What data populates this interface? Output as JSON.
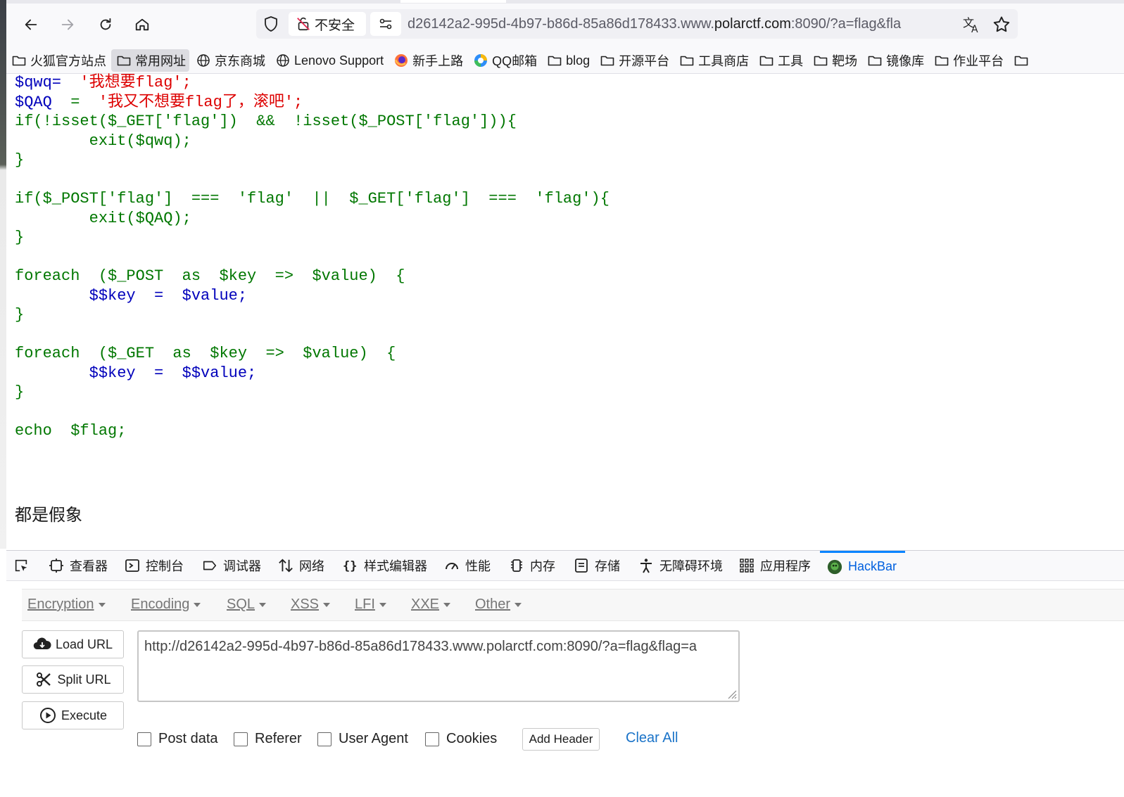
{
  "browser": {
    "security_label": "不安全",
    "url_prefix": "d26142a2-995d-4b97-b86d-85a86d178433.www.",
    "url_domain": "polarctf.com",
    "url_suffix": ":8090/?a=flag&fla"
  },
  "bookmarks": [
    {
      "label": "火狐官方站点",
      "icon": "folder-icon"
    },
    {
      "label": "常用网址",
      "icon": "folder-icon",
      "active": true
    },
    {
      "label": "京东商城",
      "icon": "globe-icon"
    },
    {
      "label": "Lenovo Support",
      "icon": "globe-icon"
    },
    {
      "label": "新手上路",
      "icon": "firefox-icon"
    },
    {
      "label": "QQ邮箱",
      "icon": "qqmail-icon"
    },
    {
      "label": "blog",
      "icon": "folder-icon"
    },
    {
      "label": "开源平台",
      "icon": "folder-icon"
    },
    {
      "label": "工具商店",
      "icon": "folder-icon"
    },
    {
      "label": "工具",
      "icon": "folder-icon"
    },
    {
      "label": "靶场",
      "icon": "folder-icon"
    },
    {
      "label": "镜像库",
      "icon": "folder-icon"
    },
    {
      "label": "作业平台",
      "icon": "folder-icon"
    }
  ],
  "code": {
    "l1_var": "$qwq=",
    "l1_str": "'我想要flag';",
    "l2_var": "$QAQ",
    "l2_eq": "=",
    "l2_str": "'我又不想要flag了，滚吧';",
    "l3": "if(!isset($_GET['flag'])  &&  !isset($_POST['flag'])){",
    "l4": "exit($qwq);",
    "l5": "}",
    "l7": "if($_POST['flag']  ===  'flag'  ||  $_GET['flag']  ===  'flag'){",
    "l8": "exit($QAQ);",
    "l9": "}",
    "l11": "foreach  ($_POST  as  $key  =>  $value)  {",
    "l12": "$$key  =  $value;",
    "l13": "}",
    "l15": "foreach  ($_GET  as  $key  =>  $value)  {",
    "l16": "$$key  =  $$value;",
    "l17": "}",
    "l19": "echo  $flag;"
  },
  "page_output": "都是假象",
  "devtools": {
    "tabs": [
      {
        "label": "查看器",
        "icon": "inspector-icon"
      },
      {
        "label": "控制台",
        "icon": "console-icon"
      },
      {
        "label": "调试器",
        "icon": "debugger-icon"
      },
      {
        "label": "网络",
        "icon": "network-icon"
      },
      {
        "label": "样式编辑器",
        "icon": "style-editor-icon"
      },
      {
        "label": "性能",
        "icon": "performance-icon"
      },
      {
        "label": "内存",
        "icon": "memory-icon"
      },
      {
        "label": "存储",
        "icon": "storage-icon"
      },
      {
        "label": "无障碍环境",
        "icon": "accessibility-icon"
      },
      {
        "label": "应用程序",
        "icon": "application-icon"
      },
      {
        "label": "HackBar",
        "icon": "hackbar-icon",
        "active": true
      }
    ]
  },
  "hackbar": {
    "menu": [
      "Encryption",
      "Encoding",
      "SQL",
      "XSS",
      "LFI",
      "XXE",
      "Other"
    ],
    "load_url": "Load URL",
    "split_url": "Split URL",
    "execute": "Execute",
    "url_value": "http://d26142a2-995d-4b97-b86d-85a86d178433.www.polarctf.com:8090/?a=flag&flag=a",
    "checkboxes": [
      "Post data",
      "Referer",
      "User Agent",
      "Cookies"
    ],
    "add_header": "Add Header",
    "clear_all": "Clear All"
  }
}
